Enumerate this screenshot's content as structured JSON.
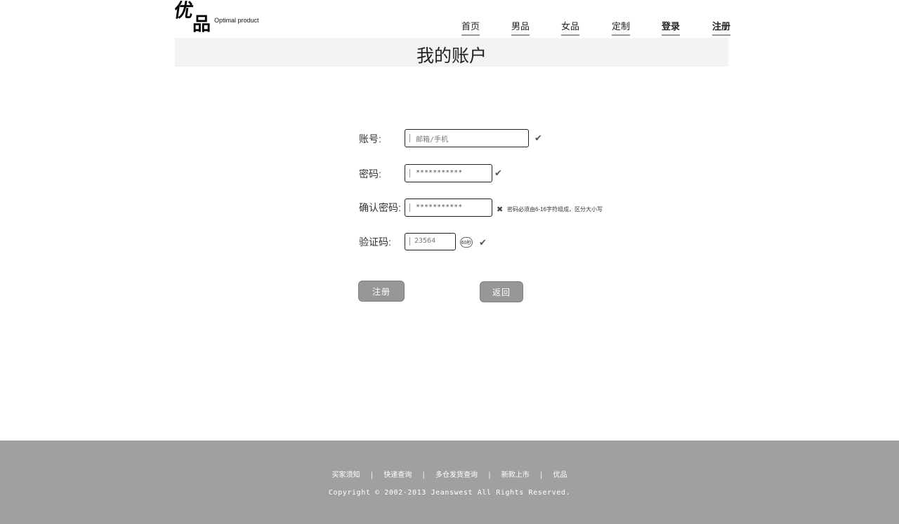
{
  "header": {
    "logo_cn_1": "优",
    "logo_cn_2": "品",
    "logo_en": "Optimal product",
    "nav": [
      "首页",
      "男品",
      "女品",
      "定制",
      "登录",
      "注册"
    ]
  },
  "page_title": "我的账户",
  "form": {
    "account": {
      "label": "账号:",
      "placeholder": "邮箱/手机",
      "status": "valid"
    },
    "password": {
      "label": "密码:",
      "value": "***********",
      "status": "valid"
    },
    "confirm": {
      "label": "确认密码:",
      "value": "***********",
      "status": "invalid",
      "error": "密码必须由6-16字符组成，区分大小写"
    },
    "captcha": {
      "label": "验证码:",
      "value": "23564",
      "timer": "60秒",
      "status": "valid"
    },
    "submit_label": "注册",
    "back_label": "返回"
  },
  "footer": {
    "links": [
      "买家须知",
      "快递查询",
      "多仓发货查询",
      "新款上市",
      "优品"
    ],
    "separator": "|",
    "copyright": "Copyright © 2002-2013 Jeanswest All Rights Reserved."
  },
  "colors": {
    "footer_bg": "#a0a0a0",
    "button_bg": "#979797",
    "title_bar_bg": "#f3f3f3"
  },
  "icons": {
    "valid": "check-icon",
    "invalid": "cross-icon"
  }
}
